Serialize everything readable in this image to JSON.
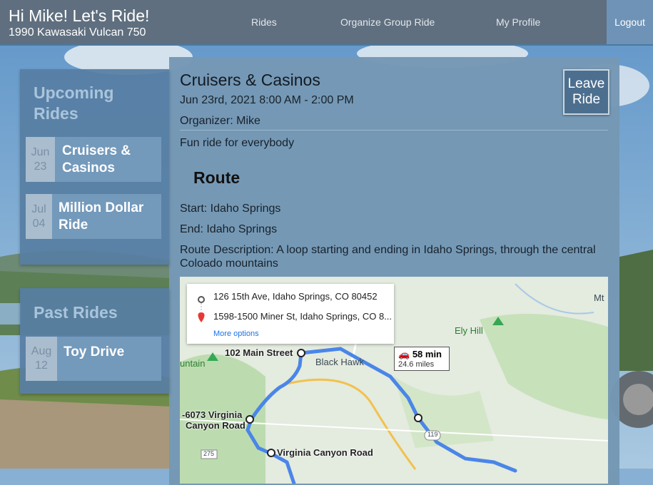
{
  "header": {
    "greeting": "Hi Mike! Let's Ride!",
    "bike": "1990 Kawasaki Vulcan 750",
    "nav": [
      "Rides",
      "Organize Group Ride",
      "My Profile"
    ],
    "logout": "Logout"
  },
  "upcoming": {
    "title": "Upcoming Rides",
    "rides": [
      {
        "month": "Jun",
        "day": "23",
        "name": "Cruisers & Casinos"
      },
      {
        "month": "Jul",
        "day": "04",
        "name": "Million Dollar Ride"
      }
    ]
  },
  "past": {
    "title": "Past Rides",
    "rides": [
      {
        "month": "Aug",
        "day": "12",
        "name": "Toy Drive"
      }
    ]
  },
  "ride": {
    "title": "Cruisers & Casinos",
    "datetime": "Jun 23rd, 2021 8:00 AM - 2:00 PM",
    "organizer": "Organizer: Mike",
    "description": "Fun ride for everybody",
    "leave_button": "Leave Ride",
    "route_heading": "Route",
    "start": "Start: Idaho Springs",
    "end": "End: Idaho Springs",
    "route_description": "Route Description: A loop starting and ending in Idaho Springs, through the central Coloado mountains"
  },
  "map": {
    "origin": "126 15th Ave, Idaho Springs, CO 80452",
    "destination": "1598-1500 Miner St, Idaho Springs, CO 8...",
    "more_options": "More options",
    "duration": "58 min",
    "distance": "24.6 miles",
    "labels": {
      "main_street": "102 Main Street",
      "black_hawk": "Black Hawk",
      "ely_hill": "Ely Hill",
      "mountain": "untain",
      "virginia_addr_1": "-6073 Virginia",
      "virginia_addr_2": "Canyon Road",
      "virginia_road": "Virginia Canyon Road",
      "mt": "Mt",
      "hwy_119": "119",
      "hwy_275": "275"
    },
    "route_color": "#4a86e8"
  }
}
